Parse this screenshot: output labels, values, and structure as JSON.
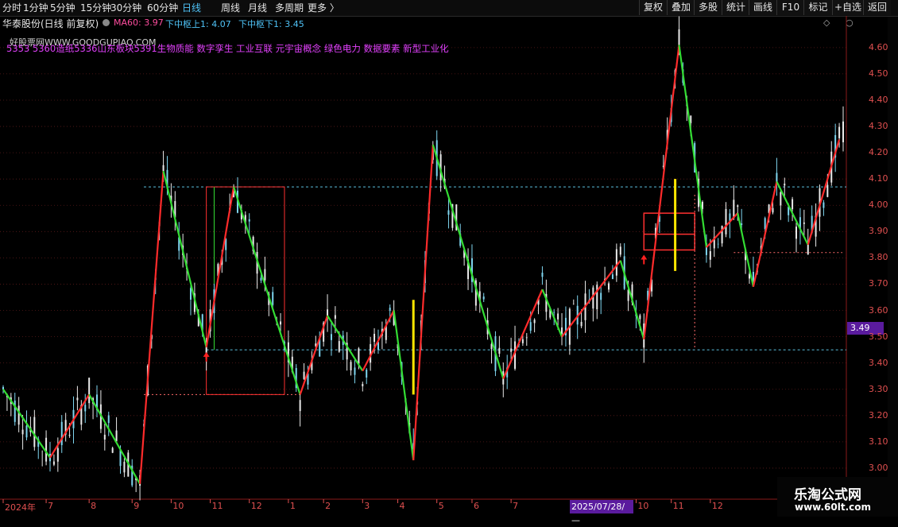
{
  "toolbar": {
    "timeframes": [
      {
        "label": "分时",
        "active": false
      },
      {
        "label": "1分钟",
        "active": false
      },
      {
        "label": "5分钟",
        "active": false
      },
      {
        "label": "15分钟",
        "active": false
      },
      {
        "label": "30分钟",
        "active": false
      },
      {
        "label": "60分钟",
        "active": false
      },
      {
        "label": "日线",
        "active": true
      },
      {
        "label": "周线",
        "active": false
      },
      {
        "label": "月线",
        "active": false
      },
      {
        "label": "多周期",
        "active": false
      },
      {
        "label": "更多 〉",
        "active": false
      }
    ],
    "right_buttons": [
      "复权",
      "叠加",
      "多股",
      "统计",
      "画线",
      "F10",
      "标记",
      "+自选",
      "返回"
    ]
  },
  "header": {
    "stock": "华泰股份(日线 前复权)",
    "ma": "MA60: 3.97",
    "zhongshu_upper": "下中枢上1: 4.07",
    "zhongshu_lower": "下中枢下1: 3.45",
    "watermark": "好股票网WWW.GOODGUPIAO.COM",
    "concepts": "5353 5360造纸5336山东板块5391生物质能 数字孪生 工业互联 元宇宙概念 绿色电力 数据要素 新型工业化"
  },
  "price_tag": "3.49",
  "badge": {
    "line1": "乐淘公式网",
    "line2": "www.60lt.com"
  },
  "colors": {
    "up": "#ff2b2b",
    "down": "#33dd33",
    "candle": "#eaeaea",
    "candle_alt": "#7fd6f0",
    "axis": "#e05050",
    "grid": "#5a1a1a",
    "box": "#ff3030",
    "dash": "#5bc0de",
    "yellow": "#ffe600"
  },
  "chart_data": {
    "type": "line",
    "ylim": [
      2.9,
      4.66
    ],
    "yticks": [
      "4.60",
      "4.50",
      "4.40",
      "4.30",
      "4.20",
      "4.10",
      "4.00",
      "3.90",
      "3.80",
      "3.70",
      "3.60",
      "3.50",
      "3.40",
      "3.30",
      "3.20",
      "3.10",
      "3.00"
    ],
    "xticks": [
      "2024年",
      "7",
      "8",
      "9",
      "10",
      "11",
      "12",
      "1",
      "2",
      "3",
      "4",
      "5",
      "6",
      "7",
      "2025/07/28/—",
      "10",
      "11",
      "12"
    ],
    "zigzag": [
      {
        "i": 0,
        "v": 3.3
      },
      {
        "i": 12,
        "v": 3.04
      },
      {
        "i": 22,
        "v": 3.28
      },
      {
        "i": 35,
        "v": 2.94
      },
      {
        "i": 41,
        "v": 4.13
      },
      {
        "i": 52,
        "v": 3.46
      },
      {
        "i": 59,
        "v": 4.07
      },
      {
        "i": 76,
        "v": 3.28
      },
      {
        "i": 83,
        "v": 3.58
      },
      {
        "i": 92,
        "v": 3.37
      },
      {
        "i": 100,
        "v": 3.6
      },
      {
        "i": 105,
        "v": 3.03
      },
      {
        "i": 110,
        "v": 4.23
      },
      {
        "i": 128,
        "v": 3.34
      },
      {
        "i": 138,
        "v": 3.68
      },
      {
        "i": 143,
        "v": 3.5
      },
      {
        "i": 158,
        "v": 3.79
      },
      {
        "i": 164,
        "v": 3.49
      },
      {
        "i": 173,
        "v": 4.61
      },
      {
        "i": 180,
        "v": 3.84
      },
      {
        "i": 188,
        "v": 3.97
      },
      {
        "i": 192,
        "v": 3.69
      },
      {
        "i": 198,
        "v": 4.09
      },
      {
        "i": 206,
        "v": 3.85
      },
      {
        "i": 214,
        "v": 4.25
      }
    ],
    "levels": {
      "upper": 4.07,
      "lower": 3.45,
      "box_top": 3.97,
      "box_mid": 3.89,
      "box_bot": 3.83
    }
  }
}
